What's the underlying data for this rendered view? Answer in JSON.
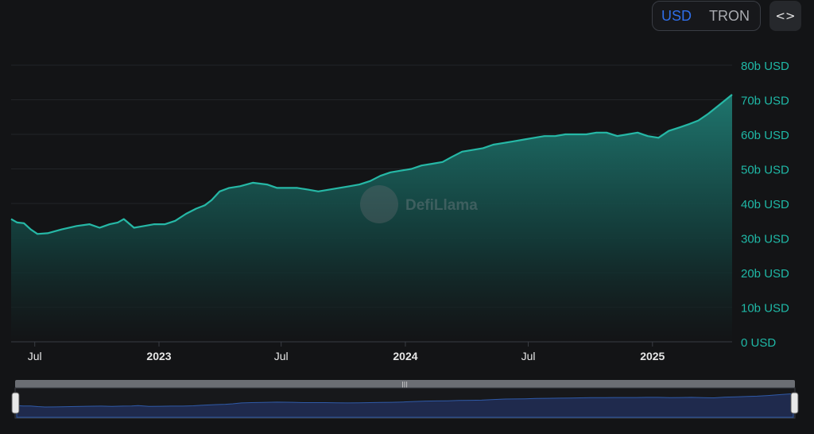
{
  "toggle": {
    "usd_label": "USD",
    "tron_label": "TRON",
    "active": "USD"
  },
  "embed_button": {
    "icon": "code-icon",
    "label": "<>"
  },
  "watermark": {
    "text": "DefiLlama"
  },
  "colors": {
    "line": "#26b8a6",
    "area_top": "#1e7d74",
    "brush_fill": "#1f2a4d",
    "brush_line": "#2f5aa8",
    "grid": "#24262a",
    "axis_label": "#1fb8a6"
  },
  "chart_data": {
    "type": "area",
    "title": "",
    "xlabel": "",
    "ylabel": "",
    "y_unit": "b USD",
    "ylim": [
      0,
      80
    ],
    "yticks": [
      0,
      10,
      20,
      30,
      40,
      50,
      60,
      70,
      80
    ],
    "ytick_labels": [
      "0 USD",
      "10b USD",
      "20b USD",
      "30b USD",
      "40b USD",
      "50b USD",
      "60b USD",
      "70b USD",
      "80b USD"
    ],
    "grid": true,
    "xlim": [
      "2022-05-27",
      "2025-04-29"
    ],
    "xticks": [
      {
        "date": "2022-07-01",
        "label": "Jul",
        "bold": false
      },
      {
        "date": "2023-01-01",
        "label": "2023",
        "bold": true
      },
      {
        "date": "2023-07-01",
        "label": "Jul",
        "bold": false
      },
      {
        "date": "2024-01-01",
        "label": "2024",
        "bold": true
      },
      {
        "date": "2024-07-01",
        "label": "Jul",
        "bold": false
      },
      {
        "date": "2025-01-01",
        "label": "2025",
        "bold": true
      }
    ],
    "series": [
      {
        "x": [
          "2022-05-27",
          "2022-06-05",
          "2022-06-15",
          "2022-06-25",
          "2022-07-05",
          "2022-07-20",
          "2022-08-10",
          "2022-09-01",
          "2022-09-20",
          "2022-10-05",
          "2022-10-20",
          "2022-11-01",
          "2022-11-10",
          "2022-11-25",
          "2022-12-10",
          "2022-12-25",
          "2023-01-10",
          "2023-01-25",
          "2023-02-10",
          "2023-02-25",
          "2023-03-10",
          "2023-03-20",
          "2023-04-01",
          "2023-04-15",
          "2023-05-01",
          "2023-05-20",
          "2023-06-10",
          "2023-06-25",
          "2023-07-10",
          "2023-07-25",
          "2023-08-10",
          "2023-08-25",
          "2023-09-10",
          "2023-09-25",
          "2023-10-10",
          "2023-10-25",
          "2023-11-10",
          "2023-11-25",
          "2023-12-10",
          "2023-12-25",
          "2024-01-10",
          "2024-01-25",
          "2024-02-10",
          "2024-02-25",
          "2024-03-10",
          "2024-03-25",
          "2024-04-10",
          "2024-04-25",
          "2024-05-10",
          "2024-05-25",
          "2024-06-10",
          "2024-06-25",
          "2024-07-10",
          "2024-07-25",
          "2024-08-10",
          "2024-08-25",
          "2024-09-10",
          "2024-09-25",
          "2024-10-10",
          "2024-10-25",
          "2024-11-10",
          "2024-11-25",
          "2024-12-10",
          "2024-12-25",
          "2025-01-10",
          "2025-01-25",
          "2025-02-10",
          "2025-02-25",
          "2025-03-10",
          "2025-03-25",
          "2025-04-10",
          "2025-04-29"
        ],
        "values": [
          35.5,
          34.5,
          34.3,
          32.5,
          31.2,
          31.4,
          32.5,
          33.5,
          34.0,
          33.0,
          34.0,
          34.5,
          35.5,
          33.0,
          33.5,
          34.0,
          34.0,
          35.0,
          37.0,
          38.5,
          39.5,
          41.0,
          43.5,
          44.5,
          45.0,
          46.0,
          45.5,
          44.5,
          44.5,
          44.5,
          44.0,
          43.5,
          44.0,
          44.5,
          45.0,
          45.5,
          46.5,
          48.0,
          49.0,
          49.5,
          50.0,
          51.0,
          51.5,
          52.0,
          53.5,
          55.0,
          55.5,
          56.0,
          57.0,
          57.5,
          58.0,
          58.5,
          59.0,
          59.5,
          59.5,
          60.0,
          60.0,
          60.0,
          60.5,
          60.5,
          59.5,
          60.0,
          60.5,
          59.5,
          59.0,
          61.0,
          62.0,
          63.0,
          64.0,
          66.0,
          68.5,
          71.5
        ]
      }
    ],
    "brush": {
      "range": [
        "2022-05-27",
        "2025-04-29"
      ]
    }
  }
}
